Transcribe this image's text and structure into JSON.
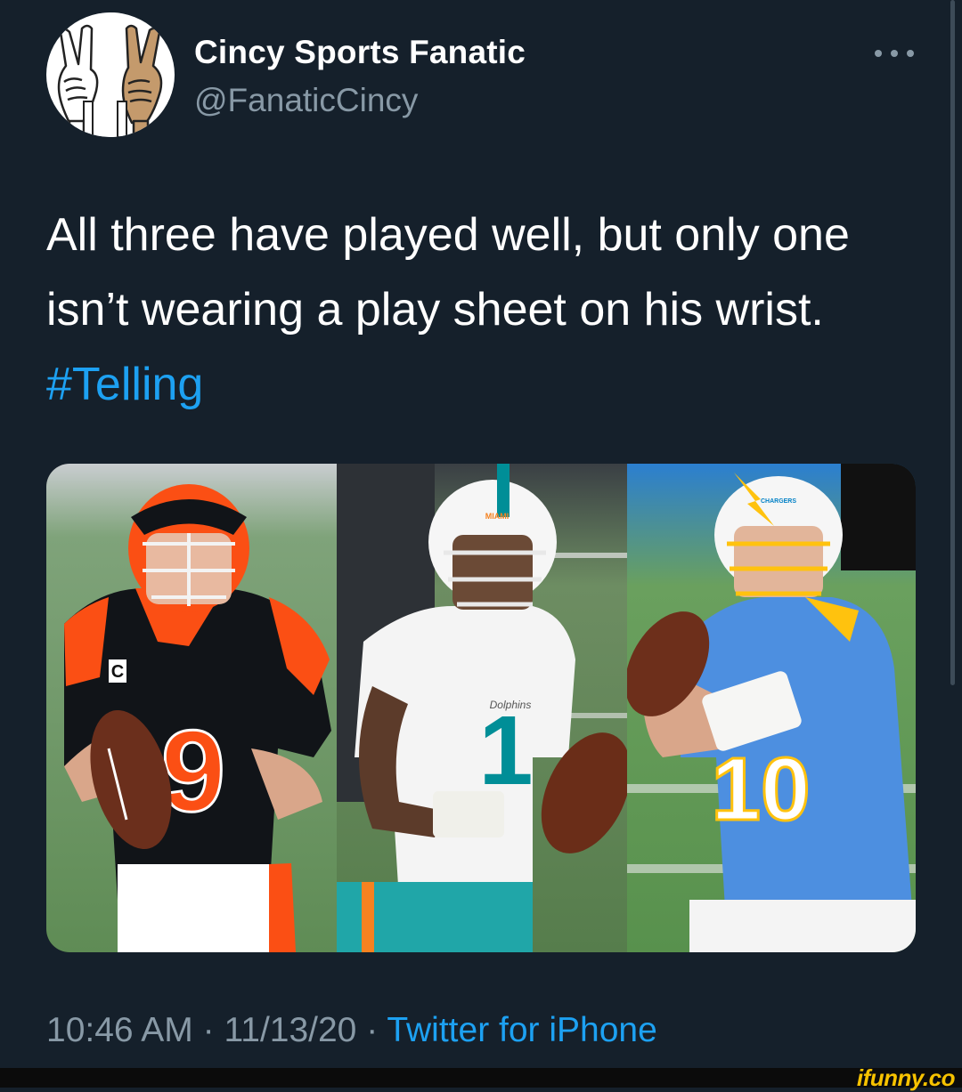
{
  "author": {
    "display_name": "Cincy Sports Fanatic",
    "handle": "@FanaticCincy",
    "avatar_icon": "peace-sign-hands-icon"
  },
  "tweet": {
    "text_line_1": "All three have played well, but only one",
    "text_line_2": "isn’t wearing a play sheet on his wrist.",
    "hashtag": "#Telling"
  },
  "media": {
    "panels": [
      {
        "team_colors": [
          "#fb4f14",
          "#101820"
        ],
        "jersey_number": "9",
        "captain_patch": "C"
      },
      {
        "team_colors": [
          "#008e97",
          "#ffffff"
        ],
        "jersey_number": "1",
        "helmet_text": "MIAMI",
        "chest_text": "Dolphins"
      },
      {
        "team_colors": [
          "#0080c6",
          "#ffc20e"
        ],
        "jersey_number": "10",
        "helmet_text": "CHARGERS"
      }
    ]
  },
  "timestamp": {
    "time": "10:46 AM",
    "separator": " · ",
    "date": "11/13/20",
    "source": "Twitter for iPhone"
  },
  "more_icon": "more-horizontal-icon",
  "watermark": "ifunny.co",
  "colors": {
    "background": "#15202b",
    "link": "#1da1f2",
    "secondary": "#8899a6"
  }
}
